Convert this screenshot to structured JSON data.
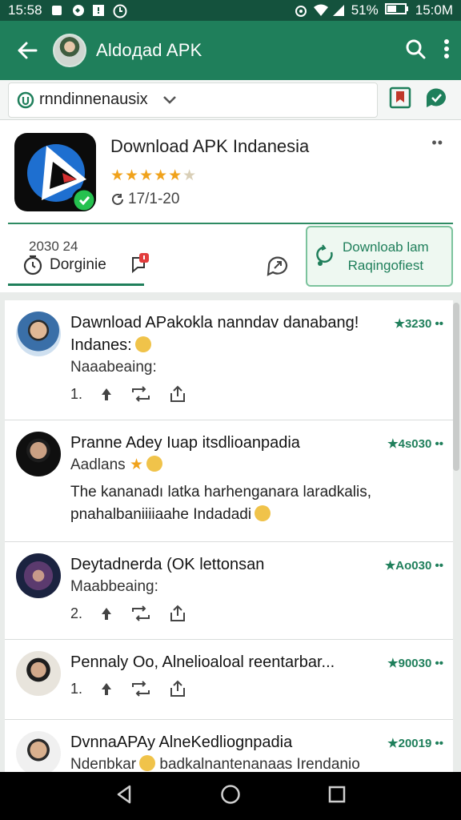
{
  "status_bar": {
    "time_left": "15:58",
    "battery": "51%",
    "time_right": "15:0M"
  },
  "app_bar": {
    "title": "Aldoдad APK"
  },
  "filter": {
    "label": "rnndinnenausix"
  },
  "app_info": {
    "name": "Download APK Indanesia",
    "rating_stars": 5,
    "rating_display": "★★★★★",
    "rating_extra": "★",
    "downloads": "17/1-20",
    "tab_count": "2030 24",
    "tab_label": "Dorginie",
    "download_button_line1": "Downloab lam",
    "download_button_line2": "Raqingofiest",
    "colors": {
      "accent": "#1f7f5b",
      "star": "#f0a21b"
    }
  },
  "posts": [
    {
      "title": "Dawnload APakokla nanndav danabang! Indanes:",
      "meta": "★3230 ••",
      "sub": "Naaabeaing:",
      "likes": "1."
    },
    {
      "title": "Pranne Adey Iuap itsdlioanpadia",
      "meta": "★4s030 ••",
      "sub": "Aadlans",
      "body": "The kananadı latka harhenganara laradkalis, pnahalbaniiiiaahe Indadadi"
    },
    {
      "title": "Deytadnerda (OK lettonsan",
      "meta": "★Ao030 ••",
      "sub": "Maabbeaing:",
      "likes": "2."
    },
    {
      "title": "Pennaly Oo, Alnelioaloal reentarbar...",
      "meta": "★90030 ••",
      "likes": "1."
    },
    {
      "title": "DvnnaAPAy AlneKedliognpadia",
      "meta": "★20019 ••",
      "sub": "Ndeпbkar",
      "sub_tail": "badkalnantenanaas Irendanio"
    }
  ]
}
